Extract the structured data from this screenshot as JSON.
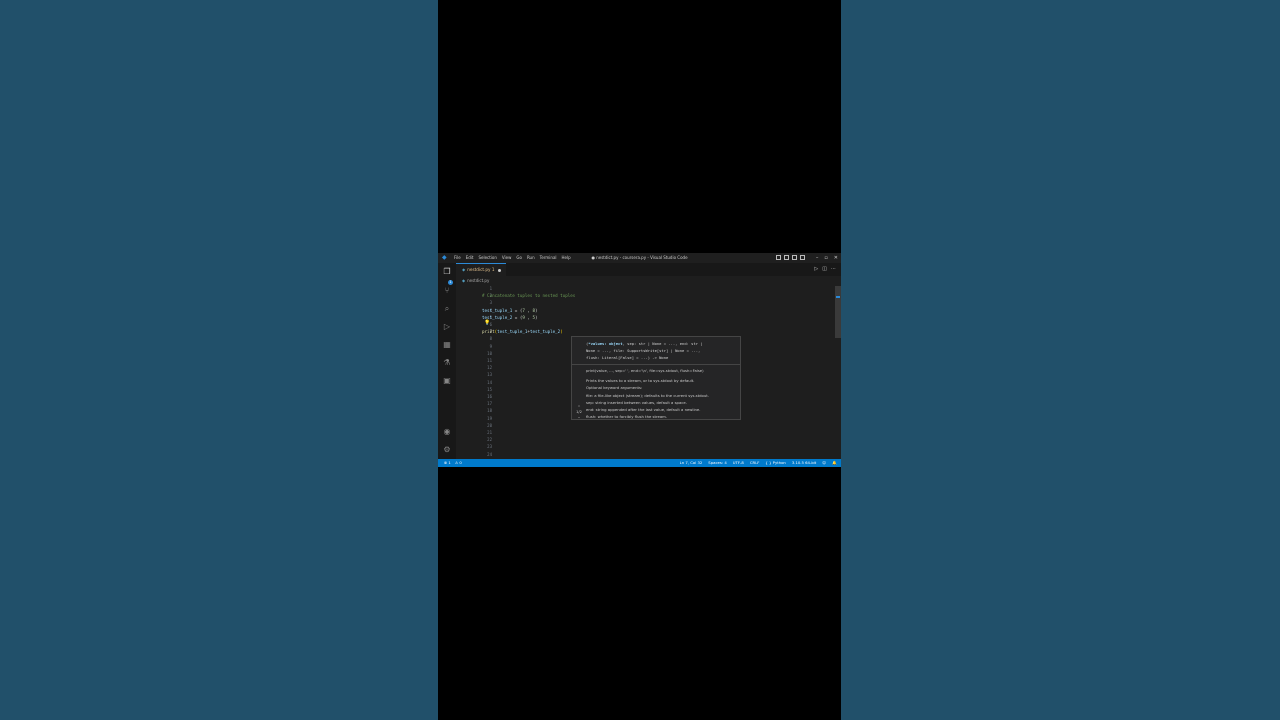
{
  "window": {
    "title": "● nestdict.py - coursera.py - Visual Studio Code",
    "menu": [
      "File",
      "Edit",
      "Selection",
      "View",
      "Go",
      "Run",
      "Terminal",
      "Help"
    ],
    "controls": [
      "–",
      "▫",
      "✕"
    ]
  },
  "tab": {
    "label": "nestdict.py",
    "badge": "1"
  },
  "breadcrumb": {
    "file": "nestdict.py"
  },
  "activity": {
    "scm_badge": "1"
  },
  "editor": {
    "line_numbers": [
      "1",
      "2",
      "3",
      "4",
      "5",
      "6",
      "7",
      "8",
      "9",
      "10",
      "11",
      "12",
      "13",
      "14",
      "15",
      "16",
      "17",
      "18",
      "19",
      "20",
      "21",
      "22",
      "23",
      "24"
    ],
    "current_line": "7",
    "lines": {
      "l2": "# Concatenate tuples to nested tuples",
      "l4_var": "test_tuple_1",
      "l4_rest": " = (",
      "l4_a": "7",
      "l4_sep": " , ",
      "l4_b": "8",
      "l4_end": ")",
      "l5_var": "test_tuple_2",
      "l5_rest": " = (",
      "l5_a": "9",
      "l5_sep": " , ",
      "l5_b": "5",
      "l5_end": ")",
      "l7_fn": "print",
      "l7_open": "(",
      "l7_a": "test_tuple_1",
      "l7_plus": "+",
      "l7_b": "test_tuple_2",
      "l7_close": ")"
    }
  },
  "hover": {
    "sig_prefix": "(",
    "sig_highlight": "*values: object",
    "sig_line1_rest": ", sep: str | None = ..., end: str |",
    "sig_line2": "None = ..., file: SupportsWrite[str] | None = ...,",
    "sig_line3": "flush: Literal[False] = ...) -> None",
    "doc": [
      "print(value, ..., sep=' ', end='\\n', file=sys.stdout, flush=False)",
      "",
      "Prints the values to a stream, or to sys.stdout by default.",
      "Optional keyword arguments:",
      "file: a file-like object (stream); defaults to the current sys.stdout.",
      "sep: string inserted between values, default a space.",
      "end: string appended after the last value, default a newline.",
      "flush: whether to forcibly flush the stream."
    ],
    "nav_counter": "1/2"
  },
  "status": {
    "errors": "⊗ 1",
    "warnings": "⚠ 0",
    "position": "Ln 7, Col 32",
    "spaces": "Spaces: 4",
    "encoding": "UTF-8",
    "eol": "CRLF",
    "language": "{ } Python",
    "interpreter": "3.10.5 64-bit"
  },
  "colors": {
    "accent": "#007acc",
    "editor_bg": "#1e1e1e",
    "page_bg": "#1f4d63"
  }
}
